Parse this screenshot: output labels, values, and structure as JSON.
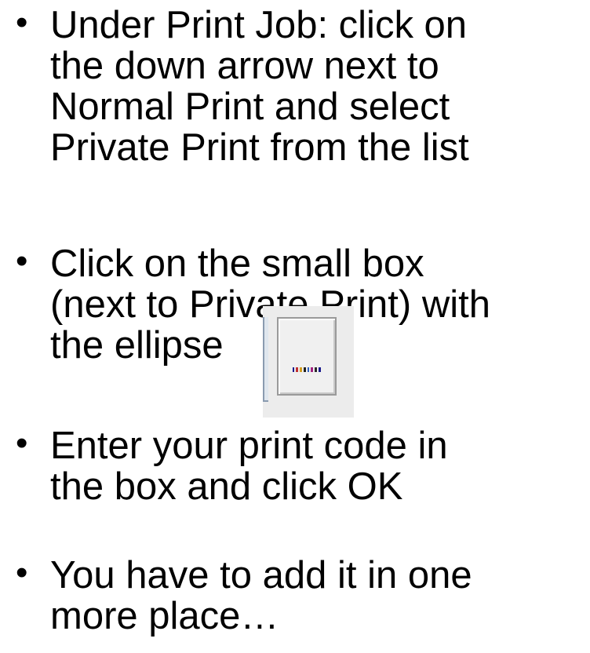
{
  "bullet_char": "•",
  "bullets": [
    {
      "lines": [
        "Under Print Job: click on",
        "the down arrow next to",
        "Normal Print and select",
        "Private Print from the list"
      ]
    },
    {
      "lines": [
        "Click on the small box",
        "(next to Private Print) with",
        "the ellipse"
      ]
    },
    {
      "lines": [
        "Enter your print code in",
        "the box and click OK"
      ]
    },
    {
      "lines": [
        "You have to add it in one",
        "more place…"
      ]
    }
  ],
  "ellipsis_button": {
    "icon": "ellipsis-icon",
    "dot_colors": [
      "#1a1a8c",
      "#c03030",
      "#d4a020",
      "#202020",
      "#3060c0",
      "#a02080",
      "#2a2a2a",
      "#1a1a8c"
    ]
  }
}
